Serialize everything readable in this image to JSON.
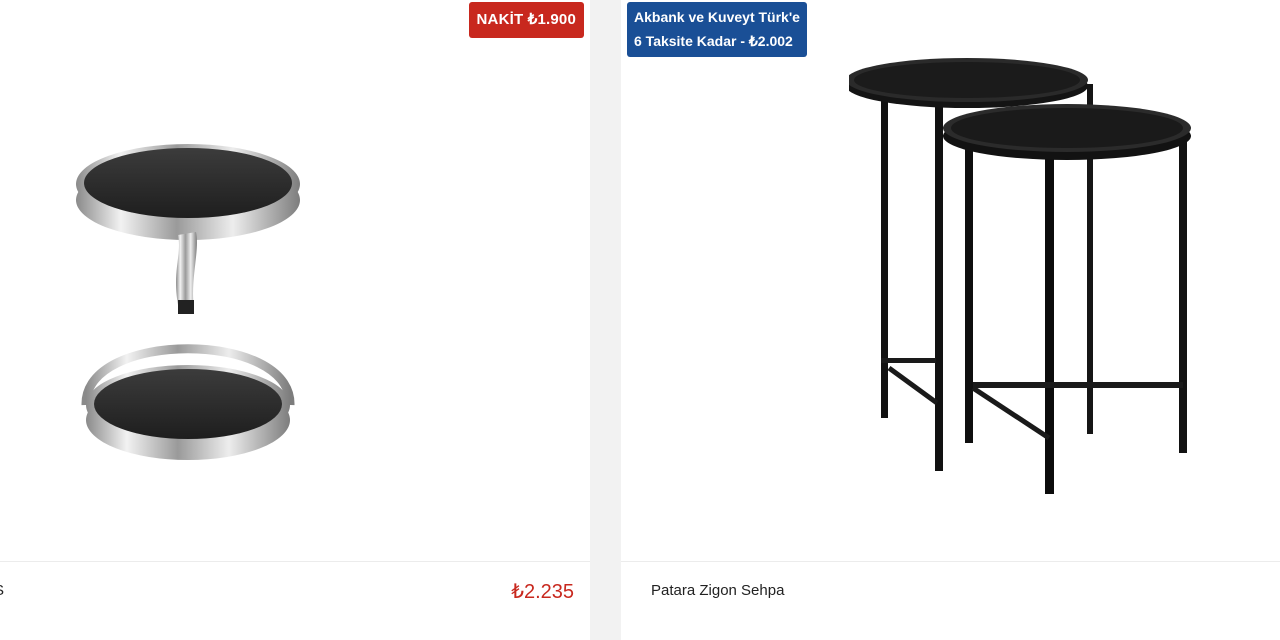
{
  "products": [
    {
      "name": "S",
      "price": "₺2.235",
      "badge": "NAKİT ₺1.900",
      "image": "side-table-chrome-black-glass"
    },
    {
      "name": "Patara Zigon Sehpa",
      "price": "",
      "badge_line1": "Akbank ve Kuveyt Türk'e",
      "badge_line2": "6 Taksite Kadar - ₺2.002",
      "image": "black-nesting-tables"
    }
  ],
  "colors": {
    "price": "#c8281e",
    "cash_badge": "#c8281e",
    "installment_badge": "#1a4f96",
    "background": "#f2f2f2"
  }
}
